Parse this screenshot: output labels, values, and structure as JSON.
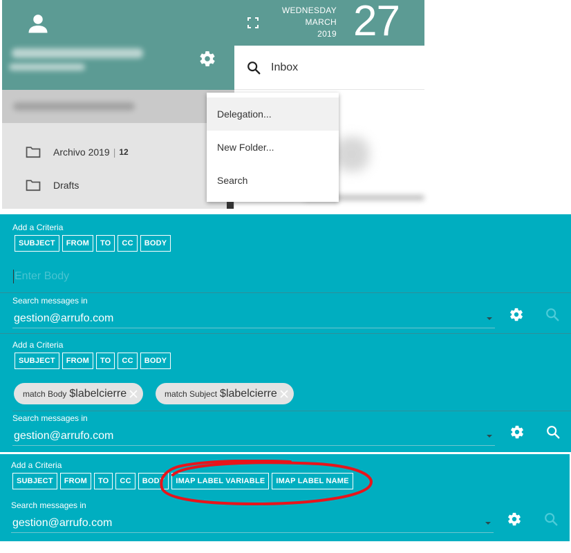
{
  "top": {
    "calendar": {
      "weekday": "WEDNESDAY",
      "month": "MARCH",
      "year": "2019",
      "day": "27"
    },
    "inbox_label": "Inbox",
    "folders": [
      {
        "name": "Archivo 2019",
        "count": "12"
      },
      {
        "name": "Drafts",
        "count": ""
      }
    ],
    "context_menu": [
      "Delegation...",
      "New Folder...",
      "Search"
    ]
  },
  "panel1": {
    "add_criteria_label": "Add a Criteria",
    "criteria": [
      "SUBJECT",
      "FROM",
      "TO",
      "CC",
      "BODY"
    ],
    "input_placeholder": "Enter Body",
    "search_in_label": "Search messages in",
    "account": "gestion@arrufo.com"
  },
  "panel2": {
    "add_criteria_label": "Add a Criteria",
    "criteria": [
      "SUBJECT",
      "FROM",
      "TO",
      "CC",
      "BODY"
    ],
    "filters": [
      {
        "prefix": "match Body",
        "value": "$labelcierre"
      },
      {
        "prefix": "match Subject",
        "value": "$labelcierre"
      }
    ],
    "search_in_label": "Search messages in",
    "account": "gestion@arrufo.com"
  },
  "panel3": {
    "add_criteria_label": "Add a Criteria",
    "criteria": [
      "SUBJECT",
      "FROM",
      "TO",
      "CC",
      "BODY",
      "IMAP LABEL VARIABLE",
      "IMAP LABEL NAME"
    ],
    "search_in_label": "Search messages in",
    "account": "gestion@arrufo.com"
  },
  "colors": {
    "panel_bg": "#00aec0",
    "header_bg": "#5c9b94",
    "annotation": "#e8141b"
  },
  "icons": [
    "user-icon",
    "gear-icon",
    "expand-icon",
    "search-icon",
    "folder-icon",
    "close-icon",
    "chevron-down-icon"
  ]
}
